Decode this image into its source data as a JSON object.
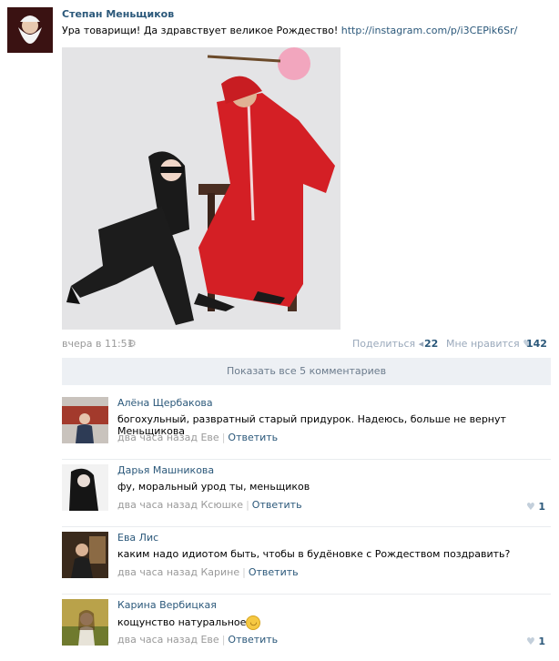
{
  "post": {
    "author": "Степан Меньщиков",
    "text": "Ура товарищи! Да здравствует великое Рождество!",
    "link": "http://instagram.com/p/i3CEPik6Sr/",
    "date": "вчера в 11:51",
    "share_label": "Поделиться",
    "share_count": "22",
    "like_label": "Мне нравится",
    "like_count": "142",
    "show_all": "Показать все 5 комментариев"
  },
  "comments": [
    {
      "name": "Алёна Щербакова",
      "text": "богохульный, развратный старый придурок. Надеюсь, больше не вернут Меньщикова",
      "time": "два часа назад Еве",
      "reply": "Ответить",
      "likes": ""
    },
    {
      "name": "Дарья Машникова",
      "text": "фу, моральный урод ты, меньщиков",
      "time": "два часа назад Ксюшке",
      "reply": "Ответить",
      "likes": "1"
    },
    {
      "name": "Ева Лис",
      "text": "каким надо идиотом быть, чтобы в будёновке с Рождеством поздравить?",
      "time": "два часа назад Карине",
      "reply": "Ответить",
      "likes": ""
    },
    {
      "name": "Карина Вербицкая",
      "text": "кощунство натуральное",
      "time": "два часа назад Еве",
      "reply": "Ответить",
      "likes": "1"
    }
  ],
  "colors": {
    "link": "#2b587a",
    "bar": "#edf0f4"
  }
}
